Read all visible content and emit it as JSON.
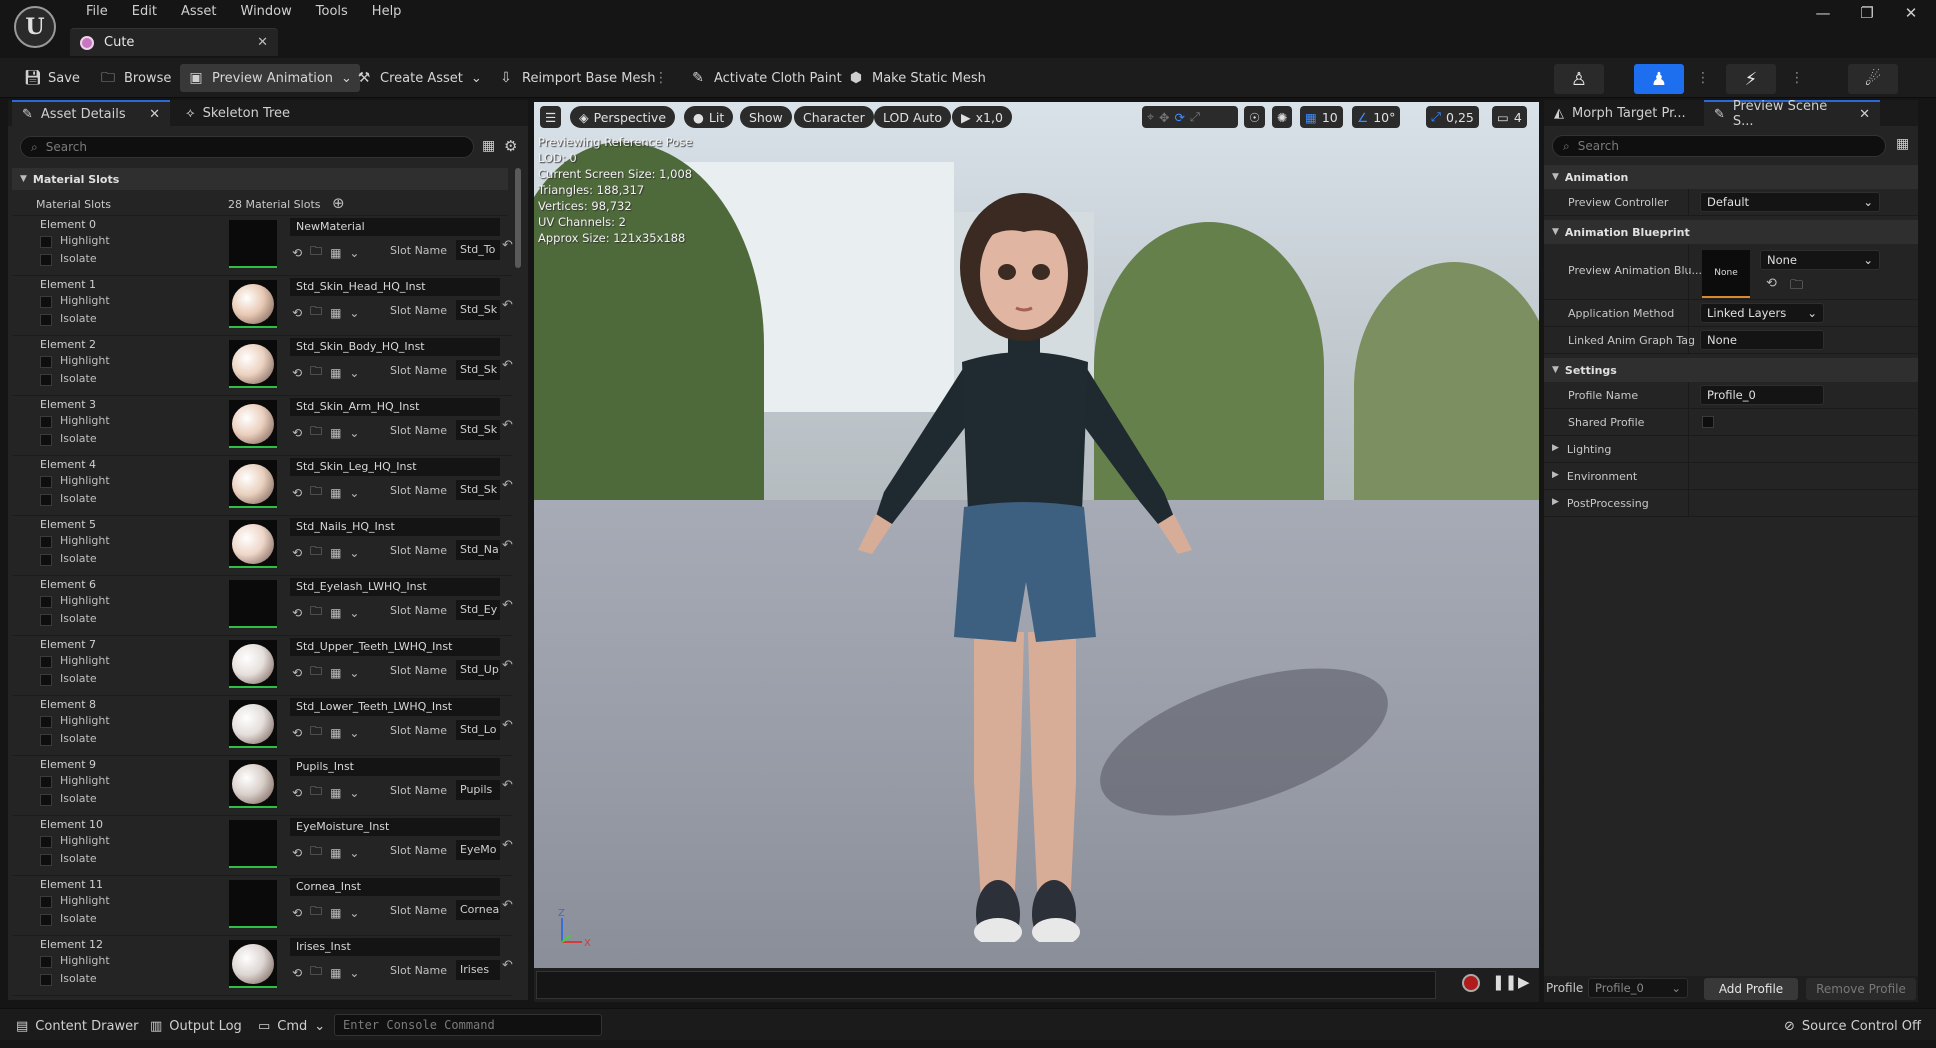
{
  "app": {
    "menu": [
      "File",
      "Edit",
      "Asset",
      "Window",
      "Tools",
      "Help"
    ],
    "document_tab": "Cute",
    "window_controls": [
      "minimize",
      "restore",
      "close"
    ]
  },
  "toolbar": {
    "save": "Save",
    "browse": "Browse",
    "preview_animation": "Preview Animation",
    "create_asset": "Create Asset",
    "reimport": "Reimport Base Mesh",
    "activate_cloth": "Activate Cloth Paint",
    "make_static": "Make Static Mesh"
  },
  "left_panel": {
    "tabs": [
      "Asset Details",
      "Skeleton Tree"
    ],
    "search_placeholder": "Search",
    "section": "Material Slots",
    "slots_label": "Material Slots",
    "slots_count": "28 Material Slots",
    "highlight": "Highlight",
    "isolate": "Isolate",
    "slot_name_label": "Slot Name",
    "elements": [
      {
        "name": "Element 0",
        "material": "NewMaterial",
        "slot": "Std_To",
        "color": "#050505"
      },
      {
        "name": "Element 1",
        "material": "Std_Skin_Head_HQ_Inst",
        "slot": "Std_Sk",
        "color": "#e8c9b4"
      },
      {
        "name": "Element 2",
        "material": "Std_Skin_Body_HQ_Inst",
        "slot": "Std_Sk",
        "color": "#ecd2c0"
      },
      {
        "name": "Element 3",
        "material": "Std_Skin_Arm_HQ_Inst",
        "slot": "Std_Sk",
        "color": "#ebcfbd"
      },
      {
        "name": "Element 4",
        "material": "Std_Skin_Leg_HQ_Inst",
        "slot": "Std_Sk",
        "color": "#ead0be"
      },
      {
        "name": "Element 5",
        "material": "Std_Nails_HQ_Inst",
        "slot": "Std_Na",
        "color": "#eed6c8"
      },
      {
        "name": "Element 6",
        "material": "Std_Eyelash_LWHQ_Inst",
        "slot": "Std_Ey",
        "color": "#030303"
      },
      {
        "name": "Element 7",
        "material": "Std_Upper_Teeth_LWHQ_Inst",
        "slot": "Std_Up",
        "color": "#e6e0dc"
      },
      {
        "name": "Element 8",
        "material": "Std_Lower_Teeth_LWHQ_Inst",
        "slot": "Std_Lo",
        "color": "#e4dedb"
      },
      {
        "name": "Element 9",
        "material": "Pupils_Inst",
        "slot": "Pupils",
        "color": "#d9cfc9"
      },
      {
        "name": "Element 10",
        "material": "EyeMoisture_Inst",
        "slot": "EyeMo",
        "color": "#060606"
      },
      {
        "name": "Element 11",
        "material": "Cornea_Inst",
        "slot": "Cornea",
        "color": "#050505"
      },
      {
        "name": "Element 12",
        "material": "Irises_Inst",
        "slot": "Irises",
        "color": "#ddd6d2"
      }
    ]
  },
  "viewport": {
    "perspective": "Perspective",
    "lit": "Lit",
    "show": "Show",
    "character": "Character",
    "lod": "LOD Auto",
    "speed": "x1,0",
    "grid_snap": "10",
    "angle_snap": "10°",
    "scale_snap": "0,25",
    "camera_speed": "4",
    "stats": [
      "Previewing Reference Pose",
      "LOD: 0",
      "Current Screen Size: 1,008",
      "Triangles: 188,317",
      "Vertices: 98,732",
      "UV Channels: 2",
      "Approx Size: 121x35x188"
    ],
    "axis_z": "Z",
    "axis_x": "X"
  },
  "right_panel": {
    "tabs": [
      "Morph Target Pr...",
      "Preview Scene S..."
    ],
    "search_placeholder": "Search",
    "animation_section": "Animation",
    "preview_controller_label": "Preview Controller",
    "preview_controller_value": "Default",
    "anim_bp_section": "Animation Blueprint",
    "preview_anim_bp_label": "Preview Animation Blu...",
    "preview_anim_bp_thumb": "None",
    "preview_anim_bp_value": "None",
    "application_method_label": "Application Method",
    "application_method_value": "Linked Layers",
    "linked_tag_label": "Linked Anim Graph Tag",
    "linked_tag_value": "None",
    "settings_section": "Settings",
    "profile_name_label": "Profile Name",
    "profile_name_value": "Profile_0",
    "shared_profile_label": "Shared Profile",
    "lighting": "Lighting",
    "environment": "Environment",
    "postprocessing": "PostProcessing",
    "footer_profile_label": "Profile",
    "footer_profile_value": "Profile_0",
    "add_profile": "Add Profile",
    "remove_profile": "Remove Profile"
  },
  "statusbar": {
    "content_drawer": "Content Drawer",
    "output_log": "Output Log",
    "cmd": "Cmd",
    "console_placeholder": "Enter Console Command",
    "source_control": "Source Control Off"
  }
}
